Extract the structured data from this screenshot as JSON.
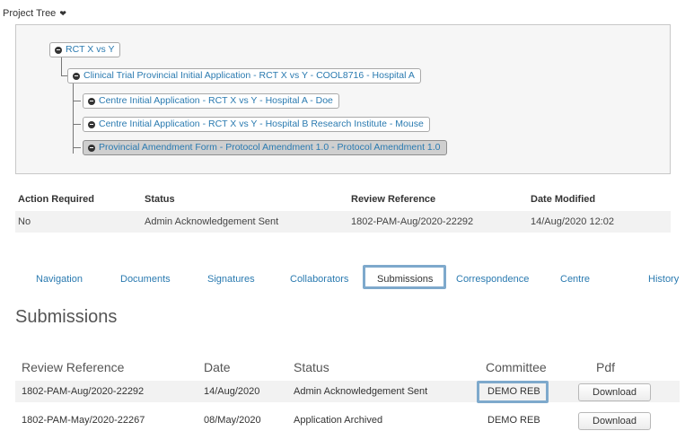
{
  "project_tree": {
    "label": "Project Tree",
    "nodes": [
      {
        "label": "RCT X vs Y"
      },
      {
        "label": "Clinical Trial Provincial Initial Application - RCT X vs Y - COOL8716 - Hospital A"
      },
      {
        "label": "Centre Initial Application - RCT X vs Y - Hospital A - Doe"
      },
      {
        "label": "Centre Initial Application - RCT X vs Y - Hospital B Research Institute - Mouse"
      },
      {
        "label": "Provincial Amendment Form - Protocol Amendment 1.0 - Protocol Amendment 1.0"
      }
    ]
  },
  "info": {
    "headers": {
      "action_required": "Action Required",
      "status": "Status",
      "review_reference": "Review Reference",
      "date_modified": "Date Modified"
    },
    "row": {
      "action_required": "No",
      "status": "Admin Acknowledgement Sent",
      "review_reference": "1802-PAM-Aug/2020-22292",
      "date_modified": "14/Aug/2020 12:02"
    }
  },
  "tabs": [
    {
      "label": "Navigation"
    },
    {
      "label": "Documents"
    },
    {
      "label": "Signatures"
    },
    {
      "label": "Collaborators"
    },
    {
      "label": "Submissions"
    },
    {
      "label": "Correspondence"
    },
    {
      "label": "Centre"
    },
    {
      "label": "History"
    }
  ],
  "active_tab": "Submissions",
  "submissions": {
    "title": "Submissions",
    "headers": {
      "review_reference": "Review Reference",
      "date": "Date",
      "status": "Status",
      "committee": "Committee",
      "pdf": "Pdf"
    },
    "rows": [
      {
        "review_reference": "1802-PAM-Aug/2020-22292",
        "date": "14/Aug/2020",
        "status": "Admin Acknowledgement Sent",
        "committee": "DEMO REB",
        "pdf": "Download"
      },
      {
        "review_reference": "1802-PAM-May/2020-22267",
        "date": "08/May/2020",
        "status": "Application Archived",
        "committee": "DEMO REB",
        "pdf": "Download"
      }
    ]
  },
  "colors": {
    "link": "#2a7ab0",
    "highlight": "#7ea9cc"
  }
}
